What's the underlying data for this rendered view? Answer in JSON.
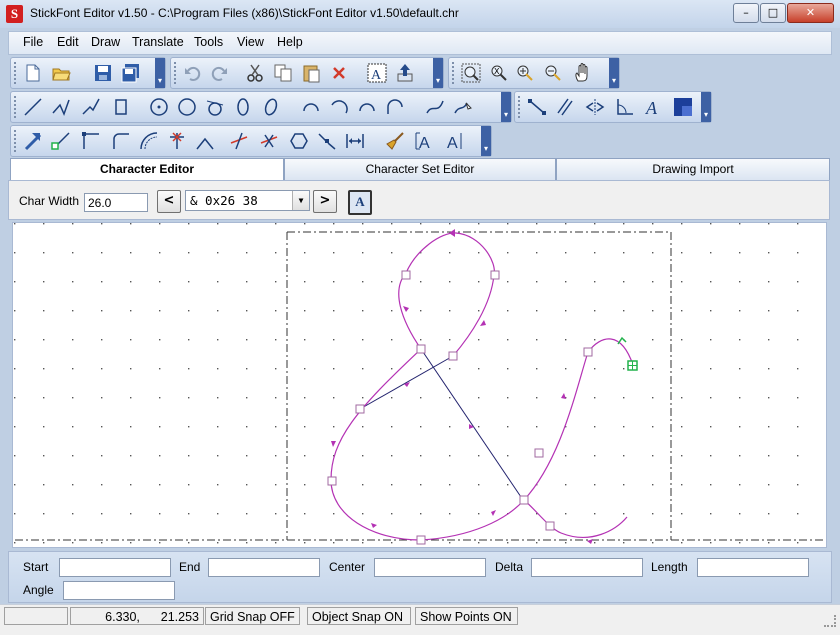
{
  "window": {
    "title": "StickFont Editor v1.50 - C:\\Program Files (x86)\\StickFont Editor v1.50\\default.chr",
    "app_icon": "S",
    "min": "–",
    "max": "□",
    "close": "✕"
  },
  "menu": [
    "File",
    "Edit",
    "Draw",
    "Translate",
    "Tools",
    "View",
    "Help"
  ],
  "tabs": [
    "Character Editor",
    "Character Set Editor",
    "Drawing Import"
  ],
  "char_editor": {
    "char_width_label": "Char Width",
    "char_width_value": "26.0",
    "prev_button": "<",
    "next_button": ">",
    "char_select": "& 0x26 38",
    "font_button": "A"
  },
  "coords": {
    "start_label": "Start",
    "end_label": "End",
    "center_label": "Center",
    "delta_label": "Delta",
    "length_label": "Length",
    "angle_label": "Angle"
  },
  "status": {
    "x": "6.330,",
    "y": "21.253",
    "grid_snap": "Grid Snap OFF",
    "object_snap": "Object Snap ON",
    "show_points": "Show Points ON"
  },
  "colors": {
    "stroke": "#b432b4",
    "construction": "#23236e",
    "endpoint": "#22b24c",
    "accent": "#3d61a4"
  }
}
